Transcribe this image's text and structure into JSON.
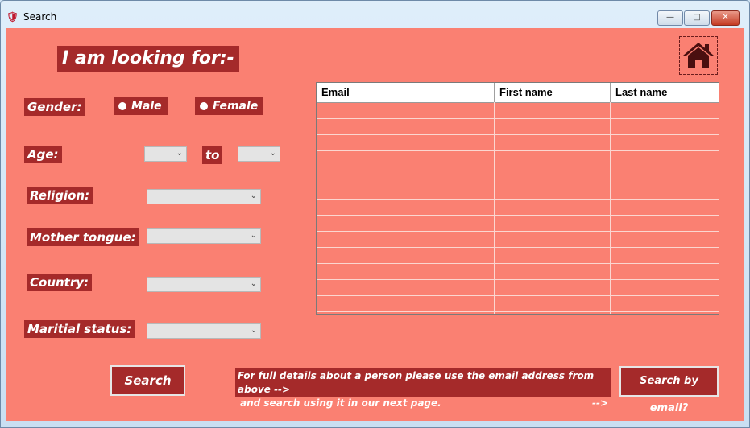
{
  "window": {
    "title": "Search",
    "controls": {
      "minimize": "—",
      "maximize": "□",
      "close": "✕"
    }
  },
  "heading": "I am looking for:-",
  "form": {
    "gender": {
      "label": "Gender:",
      "options": [
        "Male",
        "Female"
      ]
    },
    "age": {
      "label": "Age:",
      "to_label": "to"
    },
    "religion": {
      "label": "Religion:"
    },
    "mother_tongue": {
      "label": "Mother tongue:"
    },
    "country": {
      "label": "Country:"
    },
    "marital_status": {
      "label": "Maritial status:"
    }
  },
  "results_table": {
    "columns": [
      "Email",
      "First name",
      "Last name"
    ]
  },
  "buttons": {
    "search": "Search",
    "search_by_email": "Search by email?"
  },
  "note": {
    "line1": "For full details about a person please use the email address from above -->",
    "line2": "and search using it in our next page.",
    "line2_end": "-->"
  },
  "icons": {
    "home": "home-icon"
  },
  "colors": {
    "background": "#fa8072",
    "label_bg": "#a52a2a"
  }
}
